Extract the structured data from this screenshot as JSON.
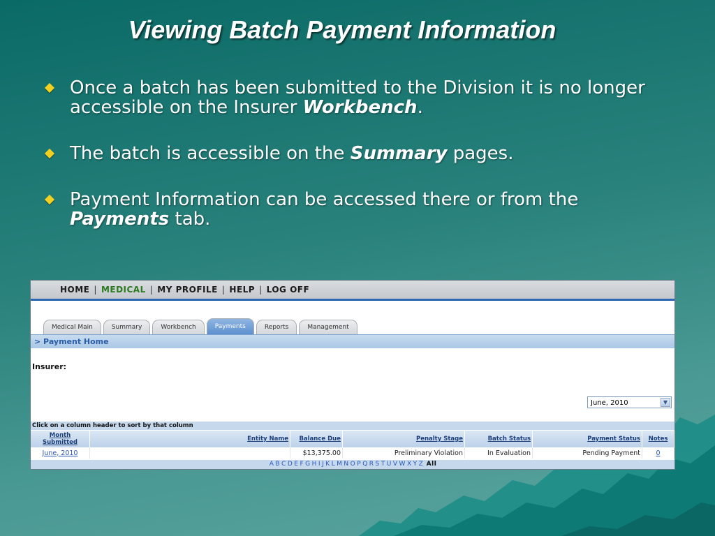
{
  "slide": {
    "title": "Viewing Batch Payment Information",
    "bullets": [
      {
        "pre": "Once a batch has been submitted to the Division it is no longer accessible on the Insurer ",
        "emph": "Workbench",
        "post": "."
      },
      {
        "pre": "The batch is accessible on the ",
        "emph": "Summary",
        "post": " pages."
      },
      {
        "pre": "Payment Information can be accessed there or from the ",
        "emph": "Payments",
        "post": " tab."
      }
    ]
  },
  "app": {
    "topnav": [
      "HOME",
      "MEDICAL",
      "MY PROFILE",
      "HELP",
      "LOG OFF"
    ],
    "tabs": [
      "Medical Main",
      "Summary",
      "Workbench",
      "Payments",
      "Reports",
      "Management"
    ],
    "breadcrumb": "> Payment Home",
    "insurer_label": "Insurer:",
    "month_select": "June, 2010",
    "sort_hint": "Click on a column header to sort by that column",
    "columns": {
      "month_line1": "Month",
      "month_line2": "Submitted",
      "entity": "Entity Name",
      "balance": "Balance Due",
      "penalty": "Penalty Stage",
      "batch": "Batch Status",
      "payment": "Payment Status",
      "notes": "Notes"
    },
    "row": {
      "month": "June, 2010",
      "entity": "",
      "balance": "$13,375.00",
      "penalty": "Preliminary Violation",
      "batch": "In Evaluation",
      "payment": "Pending Payment",
      "notes": "0"
    },
    "alphabet": [
      "A",
      "B",
      "C",
      "D",
      "E",
      "F",
      "G",
      "H",
      "I",
      "J",
      "K",
      "L",
      "M",
      "N",
      "O",
      "P",
      "Q",
      "R",
      "S",
      "T",
      "U",
      "V",
      "W",
      "X",
      "Y",
      "Z"
    ],
    "alpha_all": "All"
  },
  "colors": {
    "accent": "#2e67b3",
    "active_nav": "#2c7a1f",
    "bullet": "#f2d022"
  }
}
